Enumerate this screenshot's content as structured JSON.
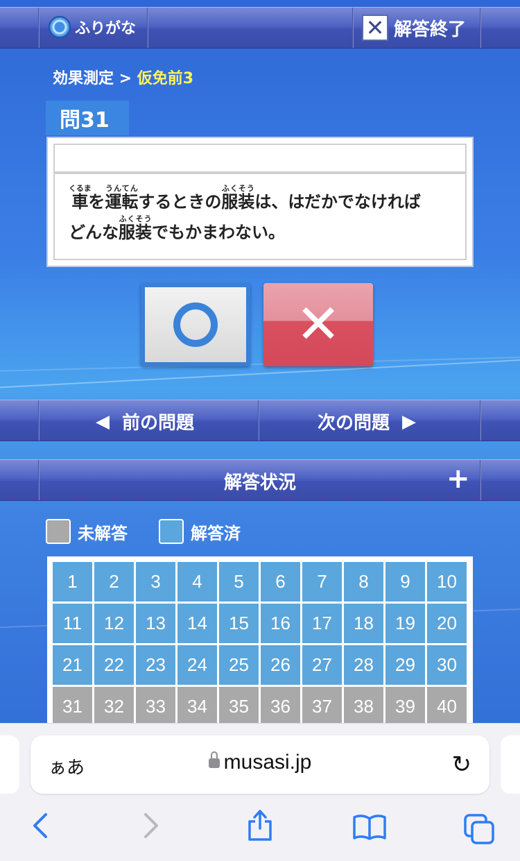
{
  "header": {
    "furigana_label": "ふりがな",
    "end_label": "解答終了"
  },
  "breadcrumb": {
    "parent": "効果測定",
    "separator": " > ",
    "current": "仮免前3"
  },
  "question": {
    "number_label": "問31",
    "text_parts": {
      "w1": "車",
      "w1_ruby": "くるま",
      "t1": "を",
      "w2": "運転",
      "w2_ruby": "うんてん",
      "t2": "するときの",
      "w3": "服装",
      "w3_ruby": "ふくそう",
      "t3": "は、はだかでなければ",
      "t4": "どんな",
      "w4": "服装",
      "w4_ruby": "ふくそう",
      "t5": "でもかまわない。"
    }
  },
  "answers": {
    "true_icon": "circle-mark-icon",
    "false_symbol": "✕"
  },
  "nav": {
    "prev_label": "前の問題",
    "next_label": "次の問題"
  },
  "status_panel": {
    "title": "解答状況",
    "expand_symbol": "+",
    "legend_unanswered": "未解答",
    "legend_answered": "解答済",
    "answered_color": "#5ba6dc",
    "unanswered_color": "#a9a9a9",
    "answered_count": 30,
    "cells": [
      "1",
      "2",
      "3",
      "4",
      "5",
      "6",
      "7",
      "8",
      "9",
      "10",
      "11",
      "12",
      "13",
      "14",
      "15",
      "16",
      "17",
      "18",
      "19",
      "20",
      "21",
      "22",
      "23",
      "24",
      "25",
      "26",
      "27",
      "28",
      "29",
      "30",
      "31",
      "32",
      "33",
      "34",
      "35",
      "36",
      "37",
      "38",
      "39",
      "40"
    ]
  },
  "browser": {
    "text_size_label": "ぁあ",
    "domain": "musasi.jp"
  }
}
